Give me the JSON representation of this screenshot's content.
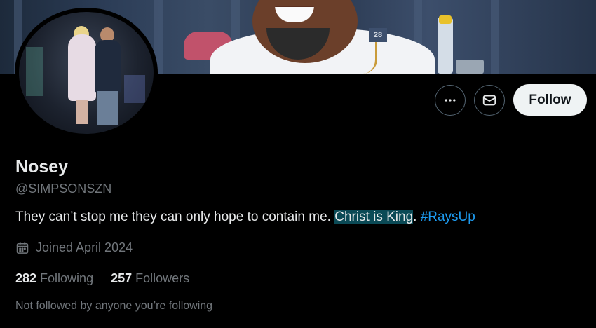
{
  "profile": {
    "display_name": "Nosey",
    "handle": "@SIMPSONSZN",
    "bio": {
      "text_before": "They can’t stop me they can only hope to contain me.",
      "highlighted": "Christ is King",
      "period": ".",
      "hashtag": "#RaysUp"
    },
    "joined": "Joined April 2024",
    "following_count": "282",
    "following_label": "Following",
    "followers_count": "257",
    "followers_label": "Followers",
    "not_followed_text": "Not followed by anyone you’re following"
  },
  "actions": {
    "follow_label": "Follow",
    "more_icon": "more-dots-icon",
    "message_icon": "envelope-icon"
  },
  "colors": {
    "background": "#000000",
    "primary_text": "#e7e9ea",
    "secondary_text": "#71767b",
    "link": "#1d9bf0",
    "highlight": "#0b4a56",
    "follow_button_bg": "#eff3f4"
  }
}
